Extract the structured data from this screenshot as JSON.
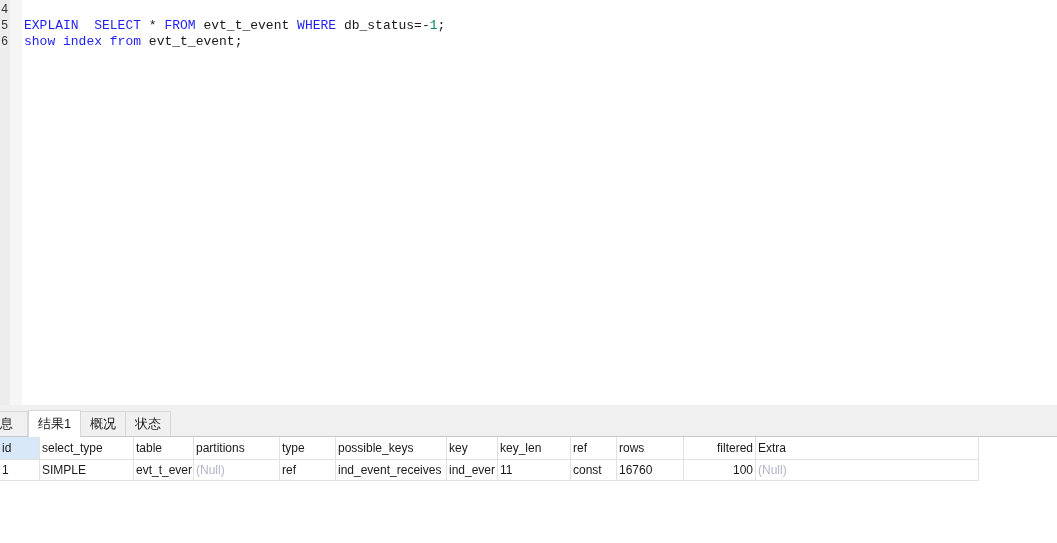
{
  "editor": {
    "lines": [
      {
        "number": "4"
      },
      {
        "number": "5",
        "tokens": [
          {
            "text": "EXPLAIN  SELECT",
            "kind": "keyword"
          },
          {
            "text": " * ",
            "kind": "plain"
          },
          {
            "text": "FROM",
            "kind": "keyword"
          },
          {
            "text": " evt_t_event ",
            "kind": "plain"
          },
          {
            "text": "WHERE",
            "kind": "keyword"
          },
          {
            "text": " db_status=-",
            "kind": "plain"
          },
          {
            "text": "1",
            "kind": "number"
          },
          {
            "text": ";",
            "kind": "plain"
          }
        ]
      },
      {
        "number": "6",
        "tokens": [
          {
            "text": "show index from",
            "kind": "keyword"
          },
          {
            "text": " evt_t_event;",
            "kind": "plain"
          }
        ]
      }
    ]
  },
  "result_tabs": [
    {
      "label": "息",
      "selected": false
    },
    {
      "label": "结果1",
      "selected": true
    },
    {
      "label": "概况",
      "selected": false
    },
    {
      "label": "状态",
      "selected": false
    }
  ],
  "table": {
    "columns": [
      {
        "label": "id",
        "kind": "text",
        "selected": true
      },
      {
        "label": "select_type",
        "kind": "text",
        "selected": false
      },
      {
        "label": "table",
        "kind": "text",
        "selected": false
      },
      {
        "label": "partitions",
        "kind": "text",
        "selected": false
      },
      {
        "label": "type",
        "kind": "text",
        "selected": false
      },
      {
        "label": "possible_keys",
        "kind": "text",
        "selected": false
      },
      {
        "label": "key",
        "kind": "text",
        "selected": false
      },
      {
        "label": "key_len",
        "kind": "text",
        "selected": false
      },
      {
        "label": "ref",
        "kind": "text",
        "selected": false
      },
      {
        "label": "rows",
        "kind": "text",
        "selected": false
      },
      {
        "label": "filtered",
        "kind": "number",
        "selected": false
      },
      {
        "label": "Extra",
        "kind": "text",
        "selected": false
      }
    ],
    "rows": [
      {
        "cells": [
          {
            "text": "1",
            "null": false
          },
          {
            "text": "SIMPLE",
            "null": false
          },
          {
            "text": "evt_t_ever",
            "null": false
          },
          {
            "text": "(Null)",
            "null": true
          },
          {
            "text": "ref",
            "null": false
          },
          {
            "text": "ind_event_receives",
            "null": false
          },
          {
            "text": "ind_ever",
            "null": false
          },
          {
            "text": "11",
            "null": false
          },
          {
            "text": "const",
            "null": false
          },
          {
            "text": "16760",
            "null": false
          },
          {
            "text": "100",
            "null": false
          },
          {
            "text": "(Null)",
            "null": true
          }
        ]
      }
    ]
  }
}
